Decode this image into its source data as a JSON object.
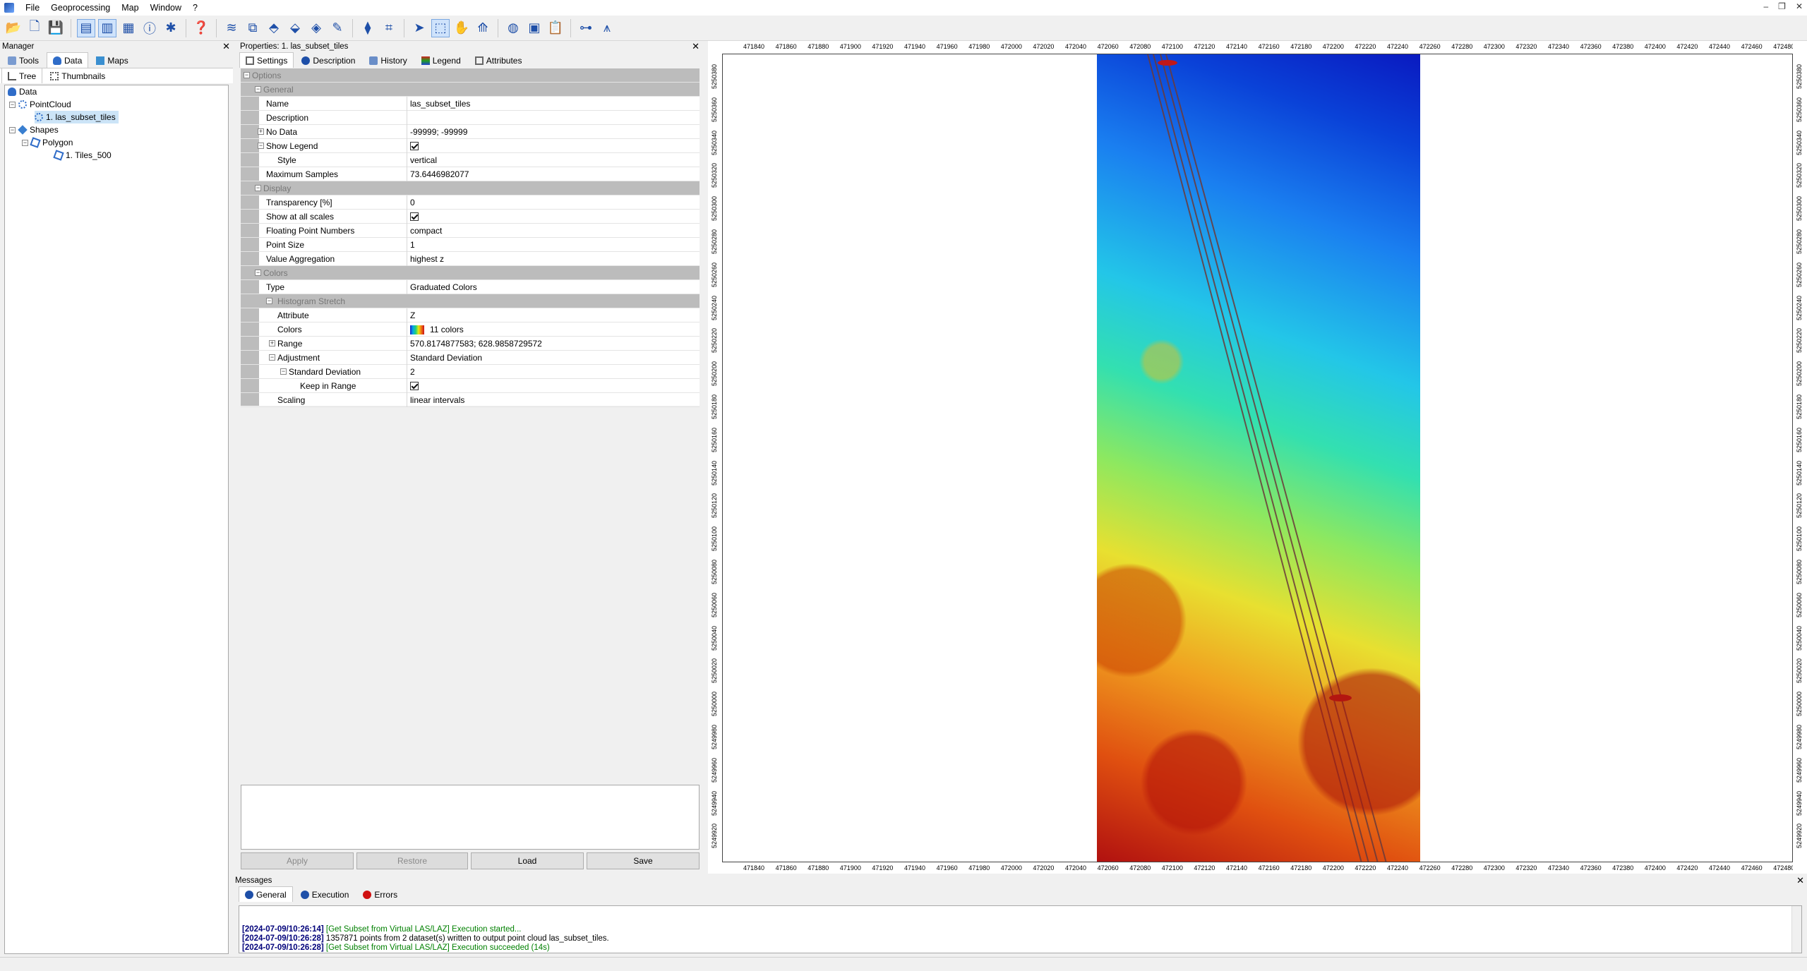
{
  "menu": {
    "file": "File",
    "geoprocessing": "Geoprocessing",
    "map": "Map",
    "window": "Window",
    "help": "?"
  },
  "manager": {
    "title": "Manager",
    "tabs": {
      "tools": "Tools",
      "data": "Data",
      "maps": "Maps"
    },
    "subtabs": {
      "tree": "Tree",
      "thumbnails": "Thumbnails"
    },
    "tree": {
      "root": "Data",
      "pointcloud": "PointCloud",
      "pc_item": "1. las_subset_tiles",
      "shapes": "Shapes",
      "polygon": "Polygon",
      "poly_item": "1. Tiles_500"
    }
  },
  "properties": {
    "title": "Properties:  1. las_subset_tiles",
    "tabs": {
      "settings": "Settings",
      "description": "Description",
      "history": "History",
      "legend": "Legend",
      "attributes": "Attributes"
    },
    "rows": {
      "options": "Options",
      "general": "General",
      "name_l": "Name",
      "name_v": "las_subset_tiles",
      "desc_l": "Description",
      "desc_v": "",
      "nodata_l": "No Data",
      "nodata_v": "-99999; -99999",
      "showlegend_l": "Show Legend",
      "style_l": "Style",
      "style_v": "vertical",
      "maxsamples_l": "Maximum Samples",
      "maxsamples_v": "73.6446982077",
      "display": "Display",
      "transparency_l": "Transparency [%]",
      "transparency_v": "0",
      "showall_l": "Show at all scales",
      "fpn_l": "Floating Point Numbers",
      "fpn_v": "compact",
      "pointsize_l": "Point Size",
      "pointsize_v": "1",
      "valagg_l": "Value Aggregation",
      "valagg_v": "highest z",
      "colors": "Colors",
      "type_l": "Type",
      "type_v": "Graduated Colors",
      "histstretch": "Histogram Stretch",
      "attribute_l": "Attribute",
      "attribute_v": "Z",
      "colors_l": "Colors",
      "colors_v": "11 colors",
      "range_l": "Range",
      "range_v": "570.8174877583; 628.9858729572",
      "adjust_l": "Adjustment",
      "adjust_v": "Standard Deviation",
      "stddev_l": "Standard Deviation",
      "stddev_v": "2",
      "keep_l": "Keep in Range",
      "scaling_l": "Scaling",
      "scaling_v": "linear intervals"
    },
    "buttons": {
      "apply": "Apply",
      "restore": "Restore",
      "load": "Load",
      "save": "Save"
    }
  },
  "map": {
    "xticks": [
      "471840",
      "471860",
      "471880",
      "471900",
      "471920",
      "471940",
      "471960",
      "471980",
      "472000",
      "472020",
      "472040",
      "472060",
      "472080",
      "472100",
      "472120",
      "472140",
      "472160",
      "472180",
      "472200",
      "472220",
      "472240",
      "472260",
      "472280",
      "472300",
      "472320",
      "472340",
      "472360",
      "472380",
      "472400",
      "472420",
      "472440",
      "472460",
      "472480"
    ],
    "yticks": [
      "5250380",
      "5250360",
      "5250340",
      "5250320",
      "5250300",
      "5250280",
      "5250260",
      "5250240",
      "5250220",
      "5250200",
      "5250180",
      "5250160",
      "5250140",
      "5250120",
      "5250100",
      "5250080",
      "5250060",
      "5250040",
      "5250020",
      "5250000",
      "5249980",
      "5249960",
      "5249940",
      "5249920"
    ]
  },
  "messages": {
    "title": "Messages",
    "tabs": {
      "general": "General",
      "execution": "Execution",
      "errors": "Errors"
    },
    "lines": [
      {
        "ts": "[2024-07-09/10:26:14]",
        "msg": "[Get Subset from Virtual LAS/LAZ] Execution started..."
      },
      {
        "ts": "[2024-07-09/10:26:28]",
        "msg": "1357871 points from 2 dataset(s) written to output point cloud las_subset_tiles."
      },
      {
        "ts": "[2024-07-09/10:26:28]",
        "msg": "[Get Subset from Virtual LAS/LAZ] Execution succeeded (14s)"
      }
    ]
  }
}
